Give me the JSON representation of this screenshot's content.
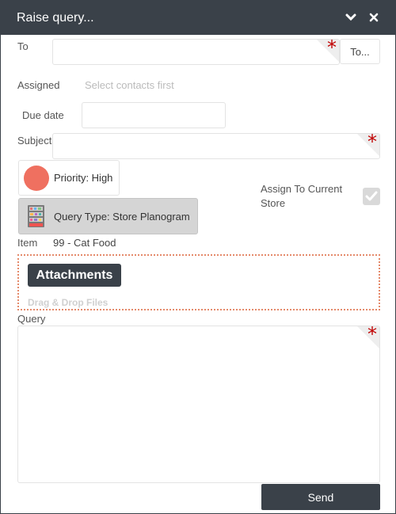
{
  "window": {
    "title": "Raise query..."
  },
  "form": {
    "to_label": "To",
    "to_value": "",
    "to_button": "To...",
    "assigned_label": "Assigned",
    "assigned_hint": "Select contacts first",
    "due_date_label": "Due date",
    "due_date_value": "",
    "subject_label": "Subject",
    "subject_value": "",
    "priority_label": "Priority: High",
    "query_type_label": "Query Type: Store Planogram",
    "assign_current_store_label": "Assign To Current Store",
    "assign_current_store_checked": true,
    "item_label": "Item",
    "item_value": "99 - Cat Food",
    "attachments_button": "Attachments",
    "drag_drop_hint": "Drag & Drop Files",
    "query_label": "Query",
    "query_value": "",
    "send_button": "Send",
    "required_marker": "*"
  },
  "colors": {
    "titlebar": "#3a4149",
    "priority_high": "#ef7060",
    "required": "#c00000",
    "dropzone_border": "#e58a6b"
  },
  "icons": {
    "minimize": "chevron-down-icon",
    "close": "close-icon",
    "query_type": "store-shelf-icon",
    "checkbox": "checkmark-icon"
  }
}
